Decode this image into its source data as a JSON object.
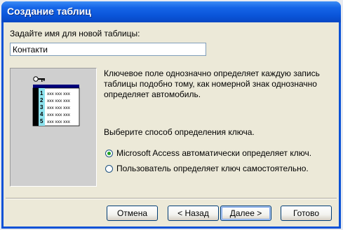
{
  "window": {
    "title": "Создание таблиц"
  },
  "form": {
    "prompt": "Задайте имя для новой таблицы:",
    "table_name": "Контакти"
  },
  "illustration": {
    "row_numbers": [
      "1",
      "2",
      "3",
      "4",
      "5"
    ],
    "cell_text": "xxx xxx xxx"
  },
  "description": {
    "text": "Ключевое поле однозначно определяет каждую запись таблицы подобно тому, как номерной знак однозначно определяет автомобиль."
  },
  "key": {
    "prompt": "Выберите способ определения ключа.",
    "options": [
      {
        "label": "Microsoft Access автоматически определяет ключ.",
        "selected": true
      },
      {
        "label": "Пользователь определяет ключ самостоятельно.",
        "selected": false
      }
    ]
  },
  "buttons": {
    "cancel": "Отмена",
    "back": "< Назад",
    "next": "Далее >",
    "finish": "Готово"
  },
  "colors": {
    "title_bar": "#0a54d8",
    "dialog_bg": "#ece9d8",
    "radio_dot": "#21a121"
  }
}
